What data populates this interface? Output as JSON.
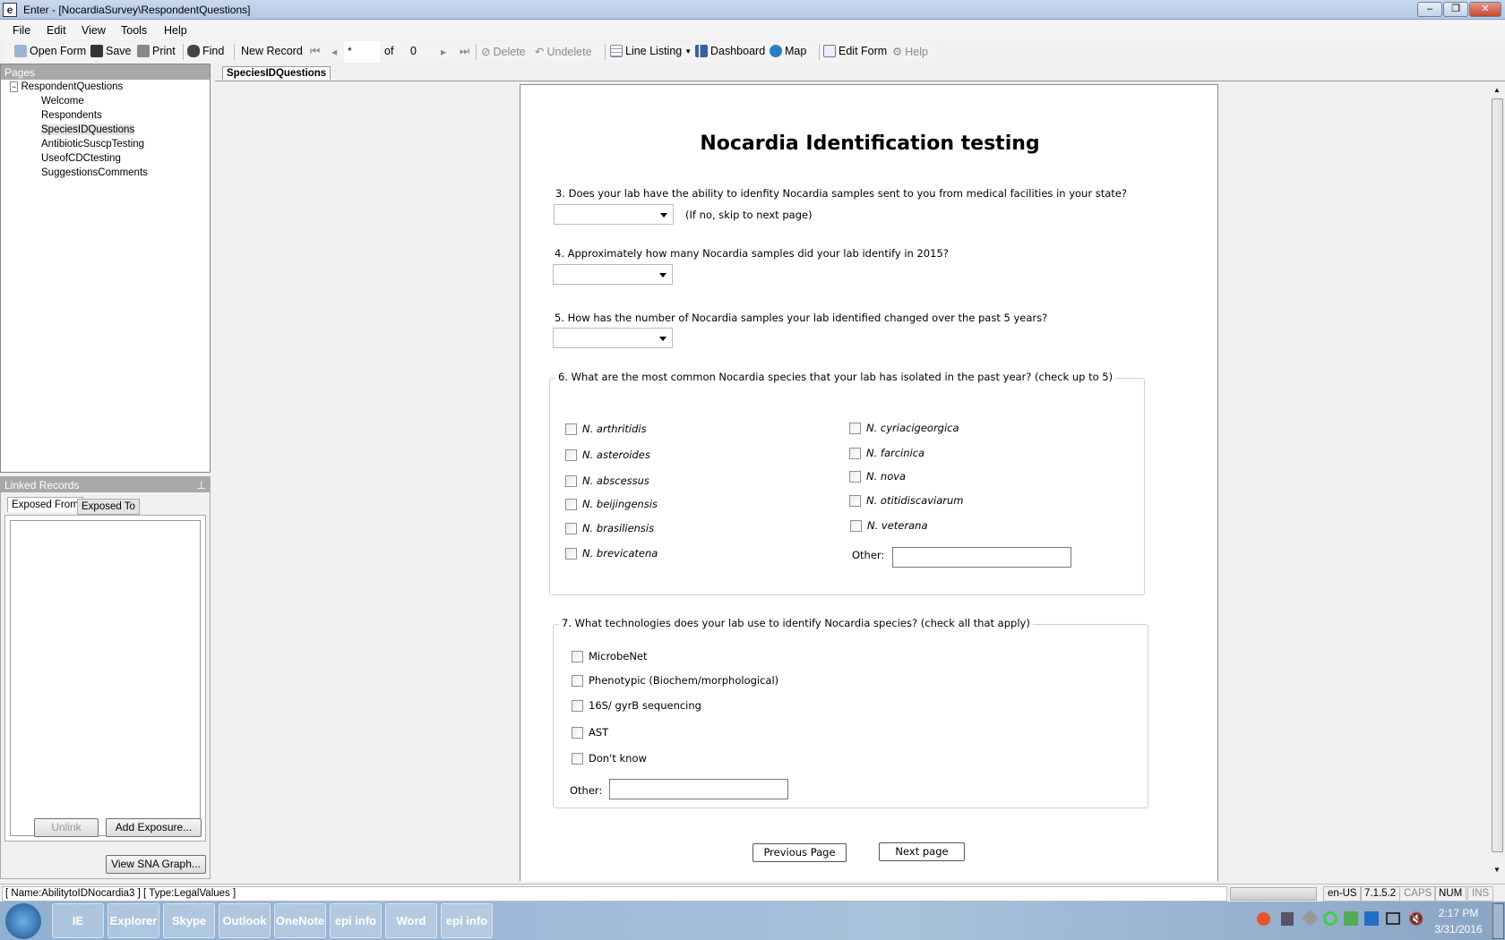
{
  "window": {
    "title": "Enter - [NocardiaSurvey\\RespondentQuestions]"
  },
  "menu": [
    "File",
    "Edit",
    "View",
    "Tools",
    "Help"
  ],
  "toolbar": {
    "open_form": "Open Form",
    "save": "Save",
    "print": "Print",
    "find": "Find",
    "new_record": "New Record",
    "record_value": "*",
    "of": "of",
    "record_count": "0",
    "delete": "Delete",
    "undelete": "Undelete",
    "line_listing": "Line Listing",
    "dashboard": "Dashboard",
    "map": "Map",
    "edit_form": "Edit Form",
    "help": "Help"
  },
  "pages_panel": {
    "title": "Pages",
    "root": "RespondentQuestions",
    "items": [
      "Welcome",
      "Respondents",
      "SpeciesIDQuestions",
      "AntibioticSuscpTesting",
      "UseofCDCtesting",
      "SuggestionsComments"
    ]
  },
  "linked": {
    "title": "Linked Records",
    "tabs": [
      "Exposed From",
      "Exposed To"
    ],
    "unlink": "Unlink",
    "add_exposure": "Add Exposure...",
    "view_sna": "View SNA Graph..."
  },
  "tab": "SpeciesIDQuestions",
  "form": {
    "title": "Nocardia Identification testing",
    "q3": "3. Does your lab have the ability to idenfity Nocardia samples sent to you from medical facilities in your state?",
    "q3_note": "(If no, skip to next page)",
    "q4": "4. Approximately how many Nocardia samples did your lab identify in 2015?",
    "q5": "5. How has the number of Nocardia samples your lab identified changed over the past 5 years?",
    "q6": "6. What are the most common Nocardia species that your lab has isolated in the past year? (check up to 5)",
    "q6_left": [
      "N. arthritidis",
      "N. asteroides",
      "N. abscessus",
      "N. beijingensis",
      "N. brasiliensis",
      "N. brevicatena"
    ],
    "q6_right": [
      "N. cyriacigeorgica",
      "N. farcinica",
      "N. nova",
      "N. otitidiscaviarum",
      "N. veterana"
    ],
    "other": "Other:",
    "q7": "7. What technologies does your lab use to identify Nocardia species? (check all that apply)",
    "q7_items": [
      "MicrobeNet",
      "Phenotypic (Biochem/morphological)",
      "16S/ gyrB sequencing",
      "AST",
      "Don't know"
    ],
    "prev": "Previous Page",
    "next": "Next page"
  },
  "status": {
    "field": "[ Name:AbilitytoIDNocardia3 ] [ Type:LegalValues ]",
    "locale": "en-US",
    "version": "7.1.5.2",
    "caps": "CAPS",
    "num": "NUM",
    "ins": "INS"
  },
  "taskbar": {
    "time": "2:17 PM",
    "date": "3/31/2016",
    "apps": [
      "IE",
      "Explorer",
      "Skype",
      "Outlook",
      "OneNote",
      "epi info",
      "Word",
      "epi info"
    ]
  }
}
